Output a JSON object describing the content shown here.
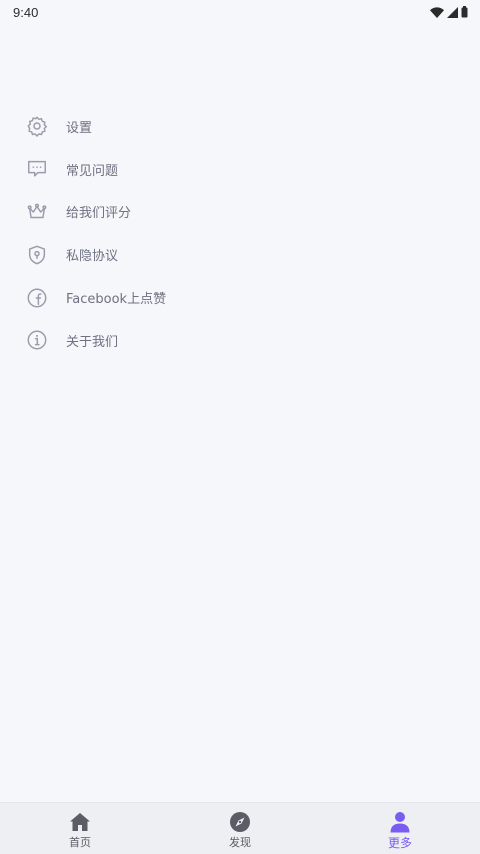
{
  "status_bar": {
    "time": "9:40",
    "icons": [
      "wifi-icon",
      "cellular-icon",
      "battery-icon"
    ]
  },
  "menu": {
    "items": [
      {
        "icon": "settings-gear-icon",
        "label": "设置"
      },
      {
        "icon": "chat-bubble-icon",
        "label": "常见问题"
      },
      {
        "icon": "crown-icon",
        "label": "给我们评分"
      },
      {
        "icon": "shield-icon",
        "label": "私隐协议"
      },
      {
        "icon": "facebook-icon",
        "label": "Facebook上点赞"
      },
      {
        "icon": "info-icon",
        "label": "关于我们"
      }
    ]
  },
  "tab_bar": {
    "tabs": [
      {
        "icon": "home-icon",
        "label": "首页",
        "active": false
      },
      {
        "icon": "compass-icon",
        "label": "发现",
        "active": false
      },
      {
        "icon": "person-icon",
        "label": "更多",
        "active": true
      }
    ]
  },
  "colors": {
    "background": "#f6f7fb",
    "icon_outline": "#9a9cab",
    "text": "#6e7181",
    "tab_bar_bg": "#eeeff3",
    "tab_icon": "#5b5d66",
    "accent": "#7a5cf0"
  }
}
